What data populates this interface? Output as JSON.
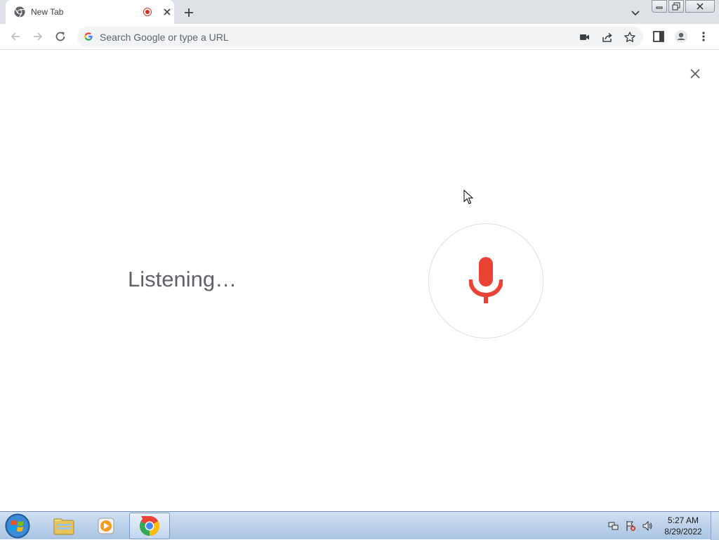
{
  "browser": {
    "tab": {
      "title": "New Tab",
      "favicon": "chrome-icon",
      "recording_indicator": "recording-dot-icon"
    },
    "omnibox": {
      "placeholder": "Search Google or type a URL"
    }
  },
  "voice_search": {
    "status_text": "Listening…",
    "mic_icon": "microphone-icon",
    "mic_color": "#ea4335"
  },
  "taskbar": {
    "clock": {
      "time": "5:27 AM",
      "date": "8/29/2022"
    },
    "apps": [
      "file-explorer-icon",
      "media-player-icon",
      "chrome-icon"
    ]
  },
  "colors": {
    "tabstrip": "#dee1e6",
    "omnibox": "#f1f3f4",
    "accent_red": "#ea4335"
  }
}
